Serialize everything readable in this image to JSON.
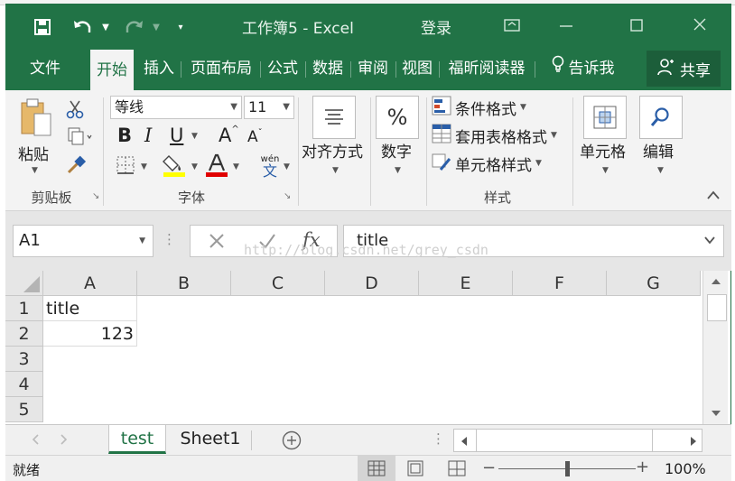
{
  "window": {
    "title": "工作簿5  -  Excel",
    "login": "登录"
  },
  "tabs": [
    "文件",
    "开始",
    "插入",
    "页面布局",
    "公式",
    "数据",
    "审阅",
    "视图",
    "福昕阅读器"
  ],
  "tell_me": "告诉我",
  "share": "共享",
  "ribbon": {
    "clipboard": {
      "paste": "粘贴",
      "label": "剪贴板"
    },
    "font": {
      "name": "等线",
      "size": "11",
      "label": "字体",
      "bold": "B",
      "italic": "I",
      "underline": "U",
      "grow": "A",
      "shrink": "A",
      "wen": "wén",
      "wen_char": "文"
    },
    "alignment": {
      "label": "对齐方式"
    },
    "number": {
      "label": "数字",
      "symbol": "%"
    },
    "styles": {
      "conditional": "条件格式",
      "table": "套用表格格式",
      "cell": "单元格样式",
      "label": "样式"
    },
    "cells": {
      "label": "单元格"
    },
    "editing": {
      "label": "编辑"
    }
  },
  "formula_bar": {
    "name_box": "A1",
    "fx": "fx",
    "content": "title"
  },
  "watermark": "http://blog.csdn.net/grey_csdn",
  "grid": {
    "columns": [
      "A",
      "B",
      "C",
      "D",
      "E",
      "F",
      "G"
    ],
    "rows": [
      "1",
      "2",
      "3",
      "4",
      "5"
    ],
    "cells": {
      "A1": "title",
      "A2": "123"
    }
  },
  "sheets": [
    "test",
    "Sheet1"
  ],
  "status": {
    "ready": "就绪",
    "zoom": "100%",
    "zoom_level": 0.5
  }
}
